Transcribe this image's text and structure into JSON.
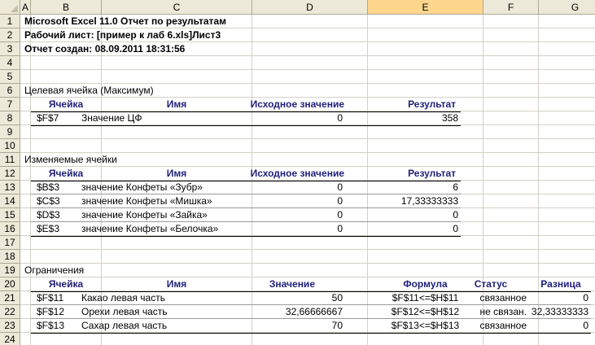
{
  "columns": [
    "A",
    "B",
    "C",
    "D",
    "E",
    "F",
    "G"
  ],
  "selected_column": "E",
  "rows": [
    "1",
    "2",
    "3",
    "4",
    "5",
    "6",
    "7",
    "8",
    "9",
    "10",
    "11",
    "12",
    "13",
    "14",
    "15",
    "16",
    "17",
    "18",
    "19",
    "20",
    "21",
    "22",
    "23",
    "24"
  ],
  "report": {
    "title": "Microsoft Excel 11.0 Отчет по результатам",
    "worksheet": "Рабочий лист: [пример к лаб 6.xls]Лист3",
    "created": "Отчет создан: 08.09.2011 18:31:56"
  },
  "target": {
    "section_title": "Целевая ячейка (Максимум)",
    "headers": {
      "cell": "Ячейка",
      "name": "Имя",
      "initial": "Исходное значение",
      "result": "Результат"
    },
    "rows": [
      {
        "cell": "$F$7",
        "name": "Значение ЦФ",
        "initial": "0",
        "result": "358"
      }
    ]
  },
  "changing": {
    "section_title": "Изменяемые ячейки",
    "headers": {
      "cell": "Ячейка",
      "name": "Имя",
      "initial": "Исходное значение",
      "result": "Результат"
    },
    "rows": [
      {
        "cell": "$B$3",
        "name": "значение Конфеты «Зубр»",
        "initial": "0",
        "result": "6"
      },
      {
        "cell": "$C$3",
        "name": "значение Конфеты «Мишка»",
        "initial": "0",
        "result": "17,33333333"
      },
      {
        "cell": "$D$3",
        "name": "значение Конфеты «Зайка»",
        "initial": "0",
        "result": "0"
      },
      {
        "cell": "$E$3",
        "name": "значение Конфеты «Белочка»",
        "initial": "0",
        "result": "0"
      }
    ]
  },
  "constraints": {
    "section_title": "Ограничения",
    "headers": {
      "cell": "Ячейка",
      "name": "Имя",
      "value": "Значение",
      "formula": "Формула",
      "status": "Статус",
      "slack": "Разница"
    },
    "rows": [
      {
        "cell": "$F$11",
        "name": "Какао левая часть",
        "value": "50",
        "formula": "$F$11<=$H$11",
        "status": "связанное",
        "slack": "0"
      },
      {
        "cell": "$F$12",
        "name": "Орехи левая часть",
        "value": "32,66666667",
        "formula": "$F$12<=$H$12",
        "status": "не связан.",
        "slack": "32,33333333"
      },
      {
        "cell": "$F$13",
        "name": "Сахар левая часть",
        "value": "70",
        "formula": "$F$13<=$H$13",
        "status": "связанное",
        "slack": "0"
      }
    ]
  }
}
